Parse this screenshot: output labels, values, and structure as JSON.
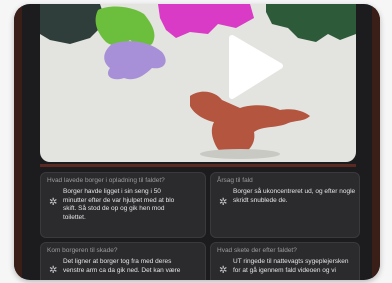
{
  "video": {
    "play_icon": "play-icon"
  },
  "cards": [
    {
      "title": "Hvad lavede borger i opladning til faldet?",
      "icon": "sparkle-icon",
      "lines": [
        "Borger havde ligget i sin seng i 50",
        "minutter efter de var hjulpet med at blo",
        "skift. Så stod de op og gik hen mod",
        "toilettet."
      ]
    },
    {
      "title": "Årsag til fald",
      "icon": "sparkle-icon",
      "lines": [
        "Borger så ukoncentreret ud, og efter nogle",
        "skridt snublede de."
      ]
    },
    {
      "title": "Kom borgeren til skade?",
      "icon": "sparkle-icon",
      "lines": [
        "Det ligner at borger tog fra med deres",
        "venstre arm ca da gik ned. Det kan være"
      ]
    },
    {
      "title": "Hvad skete der efter faldet?",
      "icon": "sparkle-icon",
      "lines": [
        "UT ringede til nattevagts sygeplejersken",
        "for at gå igennem fald videoen og vi"
      ]
    }
  ]
}
